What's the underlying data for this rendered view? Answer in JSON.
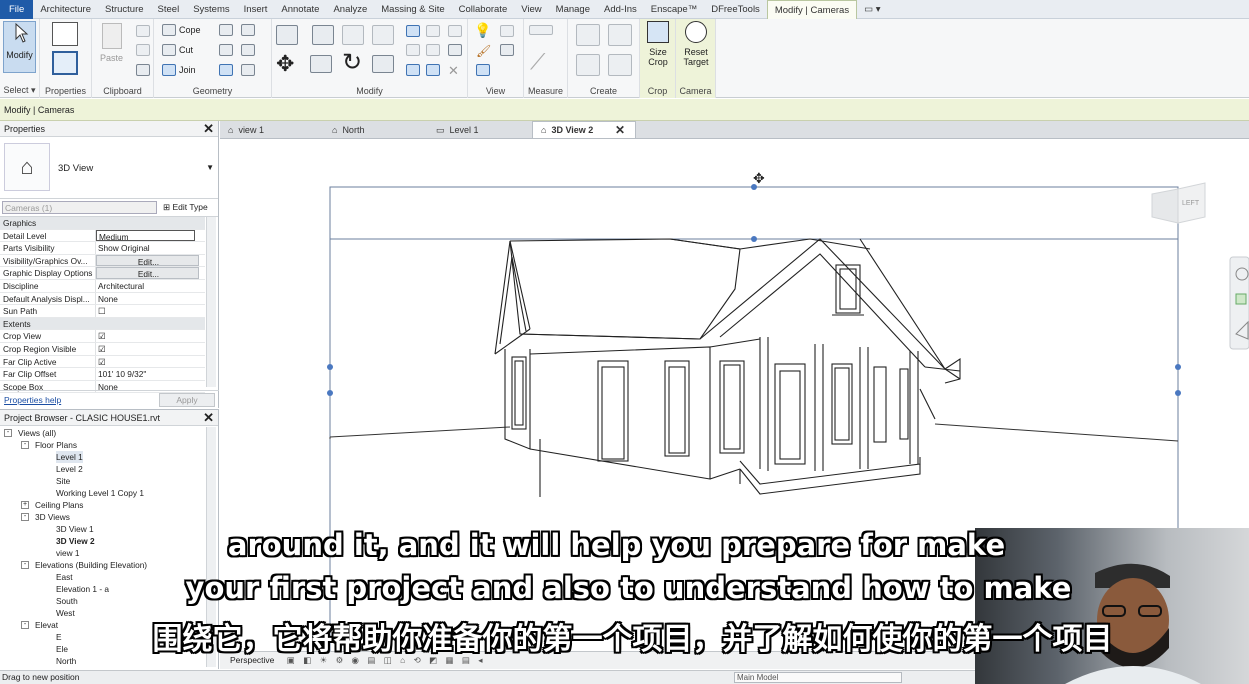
{
  "menu": {
    "items": [
      "File",
      "Architecture",
      "Structure",
      "Steel",
      "Systems",
      "Insert",
      "Annotate",
      "Analyze",
      "Massing & Site",
      "Collaborate",
      "View",
      "Manage",
      "Add-Ins",
      "Enscape™",
      "DFreeTools",
      "Modify | Cameras"
    ],
    "active": "Modify | Cameras"
  },
  "ribbon": {
    "modify_label": "Modify",
    "paste_label": "Paste",
    "cope_label": "Cope",
    "cut_label": "Cut",
    "join_label": "Join",
    "size_crop_label_1": "Size",
    "size_crop_label_2": "Crop",
    "reset_target_label_1": "Reset",
    "reset_target_label_2": "Target",
    "groups": {
      "select": "Select",
      "properties": "Properties",
      "clipboard": "Clipboard",
      "geometry": "Geometry",
      "modify": "Modify",
      "view": "View",
      "measure": "Measure",
      "create": "Create",
      "crop": "Crop",
      "camera": "Camera"
    }
  },
  "context_bar": "Modify | Cameras",
  "properties": {
    "title": "Properties",
    "type_name": "3D View",
    "instance_filter": "Cameras (1)",
    "edit_type": "Edit Type",
    "rows": [
      {
        "cat": "Graphics"
      },
      {
        "k": "Detail Level",
        "v": "Medium"
      },
      {
        "k": "Parts Visibility",
        "v": "Show Original"
      },
      {
        "k": "Visibility/Graphics Ov...",
        "v": "Edit...",
        "btn": true
      },
      {
        "k": "Graphic Display Options",
        "v": "Edit...",
        "btn": true
      },
      {
        "k": "Discipline",
        "v": "Architectural"
      },
      {
        "k": "Default Analysis Displ...",
        "v": "None"
      },
      {
        "k": "Sun Path",
        "v": "☐"
      },
      {
        "cat": "Extents"
      },
      {
        "k": "Crop View",
        "v": "☑"
      },
      {
        "k": "Crop Region Visible",
        "v": "☑"
      },
      {
        "k": "Far Clip Active",
        "v": "☑"
      },
      {
        "k": "Far Clip Offset",
        "v": "101'  10 9/32\""
      },
      {
        "k": "Scope Box",
        "v": "None"
      }
    ],
    "help": "Properties help",
    "apply": "Apply"
  },
  "browser": {
    "title": "Project Browser - CLASIC HOUSE1.rvt",
    "rows": [
      {
        "t": "Views (all)",
        "lvl": 0,
        "pm": "-"
      },
      {
        "t": "Floor Plans",
        "lvl": 1,
        "pm": "-"
      },
      {
        "t": "Level 1",
        "lvl": 2,
        "hl": true
      },
      {
        "t": "Level 2",
        "lvl": 2
      },
      {
        "t": "Site",
        "lvl": 2
      },
      {
        "t": "Working Level 1 Copy 1",
        "lvl": 2
      },
      {
        "t": "Ceiling Plans",
        "lvl": 1,
        "pm": "+"
      },
      {
        "t": "3D Views",
        "lvl": 1,
        "pm": "-"
      },
      {
        "t": "3D View 1",
        "lvl": 2
      },
      {
        "t": "3D View 2",
        "lvl": 2,
        "bold": true
      },
      {
        "t": "view 1",
        "lvl": 2
      },
      {
        "t": "Elevations (Building Elevation)",
        "lvl": 1,
        "pm": "-"
      },
      {
        "t": "East",
        "lvl": 2
      },
      {
        "t": "Elevation 1 - a",
        "lvl": 2
      },
      {
        "t": "South",
        "lvl": 2
      },
      {
        "t": "West",
        "lvl": 2
      },
      {
        "t": "Elevat",
        "lvl": 1,
        "pm": "-"
      },
      {
        "t": "E",
        "lvl": 2
      },
      {
        "t": "Ele",
        "lvl": 2
      },
      {
        "t": "North",
        "lvl": 2
      }
    ]
  },
  "tabs": [
    "view 1",
    "North",
    "Level 1",
    "3D View 2"
  ],
  "active_tab": "3D View 2",
  "viewcube": {
    "face_left": "LEFT"
  },
  "view_control": "Perspective",
  "status": {
    "text": "Drag to new position",
    "model": "Main Model"
  },
  "subtitles": {
    "line1": "around it, and it will help you prepare for make",
    "line2": "your first project and also to understand how to make",
    "line3": "围绕它，它将帮助你准备你的第一个项目，并了解如何使你的第一个项目"
  }
}
